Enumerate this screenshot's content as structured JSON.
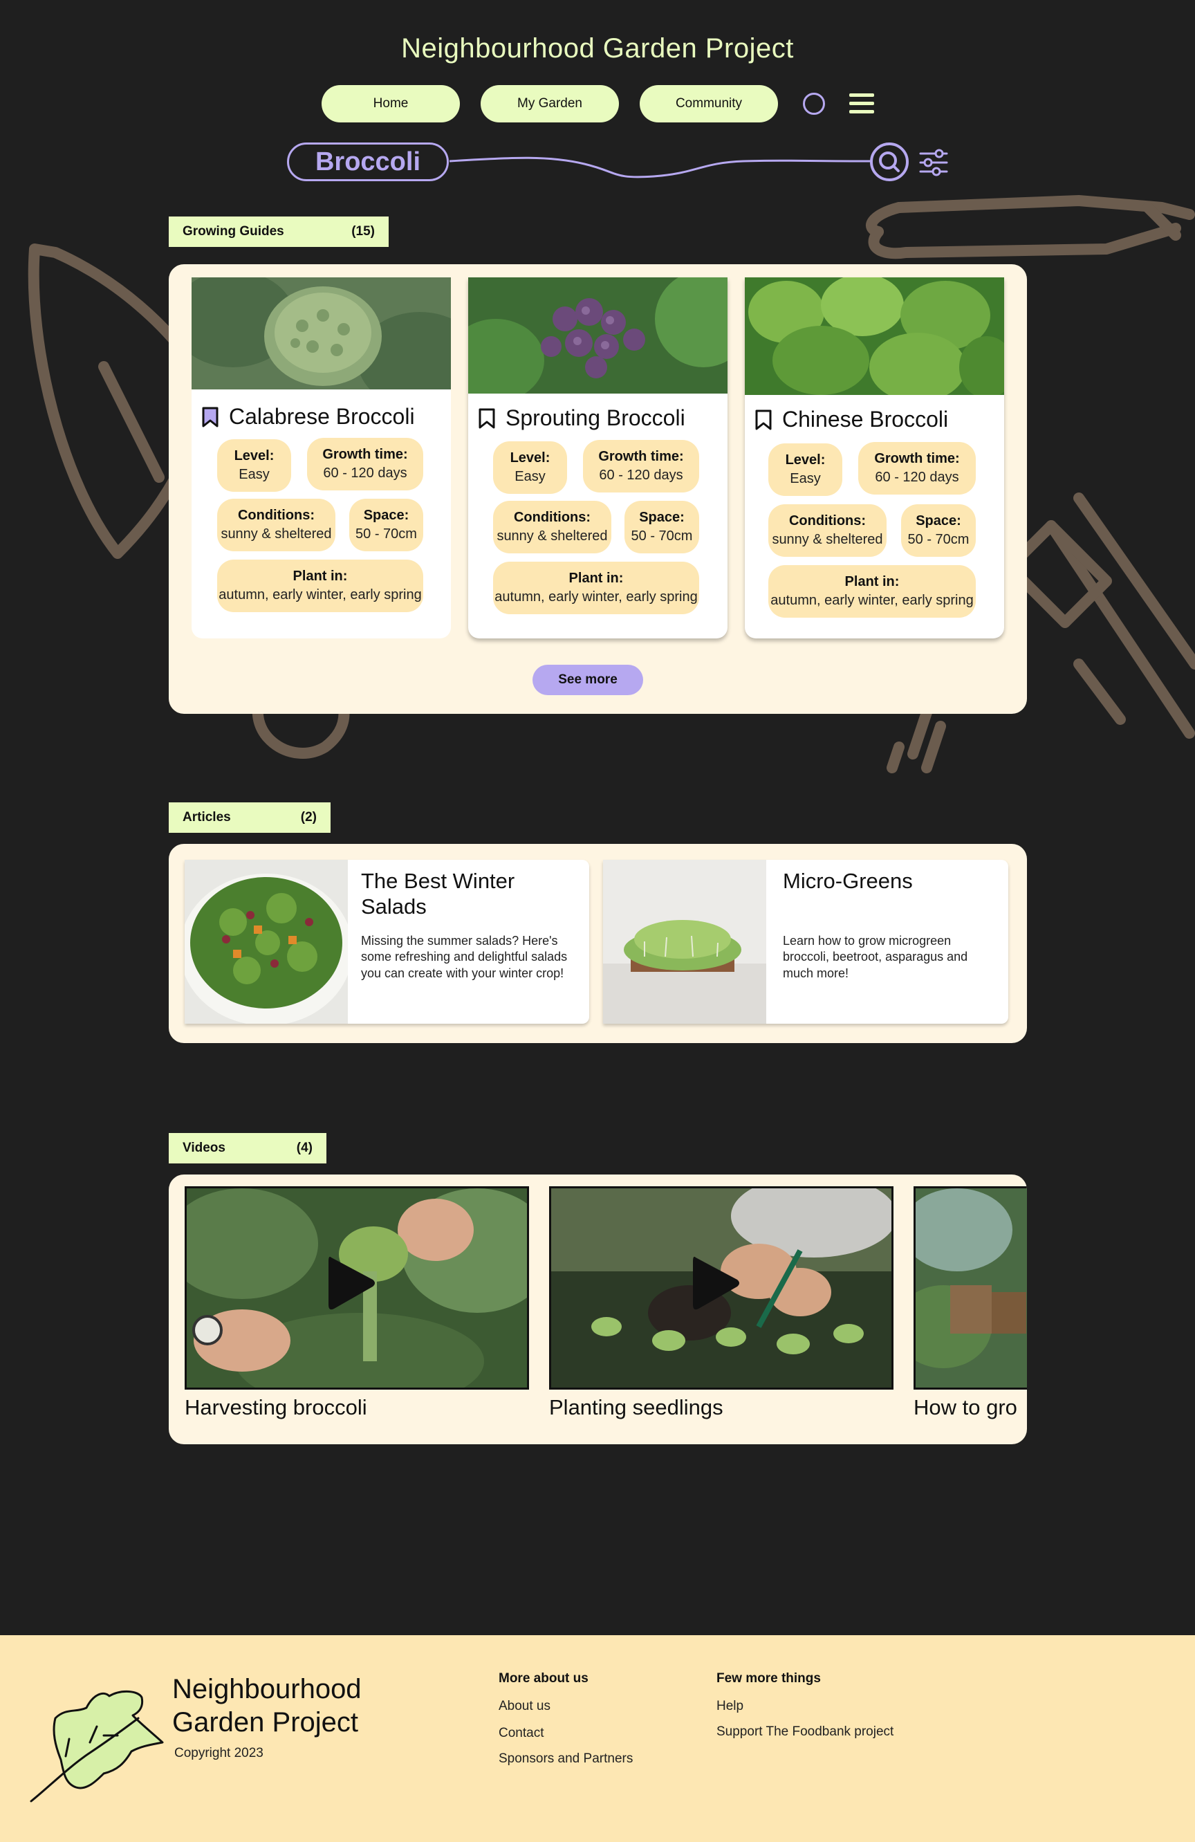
{
  "site": {
    "title": "Neighbourhood Garden Project"
  },
  "nav": {
    "items": [
      {
        "label": "Home"
      },
      {
        "label": "My Garden"
      },
      {
        "label": "Community"
      }
    ]
  },
  "search": {
    "query": "Broccoli"
  },
  "growing_guides": {
    "label": "Growing Guides",
    "count": "(15)",
    "cards": [
      {
        "title": "Calabrese Broccoli",
        "bookmarked": true,
        "level_label": "Level:",
        "level": "Easy",
        "growth_label": "Growth time:",
        "growth": "60 - 120 days",
        "conditions_label": "Conditions:",
        "conditions": "sunny & sheltered",
        "space_label": "Space:",
        "space": "50 - 70cm",
        "plant_label": "Plant in:",
        "plant": "autumn, early winter, early spring"
      },
      {
        "title": "Sprouting Broccoli",
        "bookmarked": false,
        "level_label": "Level:",
        "level": "Easy",
        "growth_label": "Growth time:",
        "growth": "60 - 120 days",
        "conditions_label": "Conditions:",
        "conditions": "sunny & sheltered",
        "space_label": "Space:",
        "space": "50 - 70cm",
        "plant_label": "Plant in:",
        "plant": "autumn, early winter, early spring"
      },
      {
        "title": "Chinese Broccoli",
        "bookmarked": false,
        "level_label": "Level:",
        "level": "Easy",
        "growth_label": "Growth time:",
        "growth": "60 - 120 days",
        "conditions_label": "Conditions:",
        "conditions": "sunny & sheltered",
        "space_label": "Space:",
        "space": "50 - 70cm",
        "plant_label": "Plant in:",
        "plant": "autumn, early winter, early spring"
      }
    ],
    "see_more": "See more"
  },
  "articles": {
    "label": "Articles",
    "count": "(2)",
    "items": [
      {
        "title": "The Best Winter Salads",
        "desc": "Missing the summer salads? Here's some refreshing and delightful salads you can create with your winter crop!"
      },
      {
        "title": "Micro-Greens",
        "desc": "Learn how to grow microgreen broccoli, beetroot, asparagus and much more!"
      }
    ]
  },
  "videos": {
    "label": "Videos",
    "count": "(4)",
    "items": [
      {
        "title": "Harvesting broccoli"
      },
      {
        "title": "Planting seedlings"
      },
      {
        "title": "How to gro"
      }
    ]
  },
  "footer": {
    "brand_line1": "Neighbourhood",
    "brand_line2": "Garden Project",
    "copyright": "Copyright 2023",
    "col1": {
      "heading": "More about us",
      "links": [
        "About us",
        "Contact",
        "Sponsors and Partners"
      ]
    },
    "col2": {
      "heading": "Few more things",
      "links": [
        "Help",
        "Support The Foodbank project"
      ]
    }
  },
  "colors": {
    "background": "#1f1f1f",
    "accent_green": "#e9fbbf",
    "accent_purple": "#b6a8f0",
    "panel": "#fef5e2",
    "chip": "#fde7b3",
    "tool_outline": "#6b5c4e"
  }
}
